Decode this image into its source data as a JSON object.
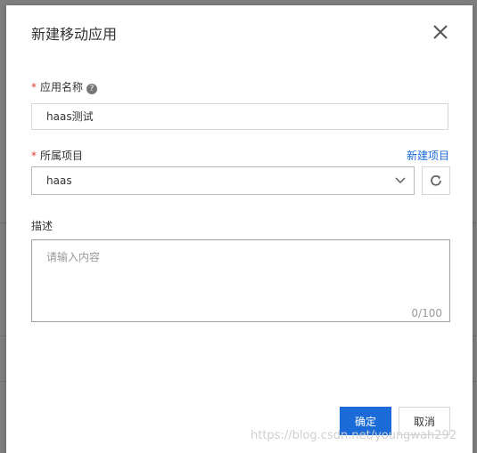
{
  "dialog": {
    "title": "新建移动应用",
    "fields": {
      "app_name": {
        "label": "应用名称",
        "value": "haas测试",
        "required_mark": "*"
      },
      "project": {
        "label": "所属项目",
        "value": "haas",
        "required_mark": "*",
        "new_link": "新建项目"
      },
      "description": {
        "label": "描述",
        "placeholder": "请输入内容",
        "counter": "0/100"
      }
    },
    "buttons": {
      "confirm": "确定",
      "cancel": "取消"
    }
  },
  "watermark": "https://blog.csdn.net/youngwah292",
  "icons": {
    "close": "close-icon",
    "help": "help-icon",
    "chevron": "chevron-down-icon",
    "refresh": "refresh-icon"
  },
  "colors": {
    "primary": "#1a6ad8",
    "required": "#e23b31"
  }
}
